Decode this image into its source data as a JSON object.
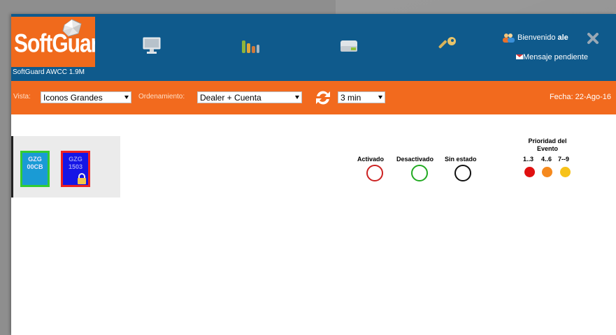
{
  "header": {
    "logo_text": "SoftGuard",
    "version": "SoftGuard AWCC 1.9M",
    "nav_icons": [
      "monitor-icon",
      "bar-chart-icon",
      "inbox-icon",
      "key-icon"
    ],
    "welcome_prefix": "Bienvenido",
    "user_name": "ale",
    "message": "Mensaje pendiente"
  },
  "toolbar": {
    "vista_label": "Vista:",
    "vista_value": "Iconos Grandes",
    "orden_label": "Ordenamiento:",
    "orden_value": "Dealer + Cuenta",
    "refresh_value": "3 min",
    "fecha": "Fecha: 22-Ago-16"
  },
  "accounts": [
    {
      "line1": "GZG",
      "line2": "00CB",
      "status": "desactivado",
      "locked": false
    },
    {
      "line1": "GZG",
      "line2": "1503",
      "status": "activado",
      "locked": true
    }
  ],
  "legend": {
    "activado": "Activado",
    "desactivado": "Desactivado",
    "sin_estado": "Sin estado",
    "priority_title": "Prioridad del Evento",
    "priority_ranges": [
      "1..3",
      "4..6",
      "7--9"
    ]
  },
  "colors": {
    "header_blue": "#0f5a8c",
    "toolbar_orange": "#f26a1e",
    "activado_red": "#cc2222",
    "desactivado_green": "#22aa22",
    "sin_estado_black": "#111111",
    "prio_low": "#e01010",
    "prio_mid": "#f5891e",
    "prio_high": "#f7c21a"
  }
}
